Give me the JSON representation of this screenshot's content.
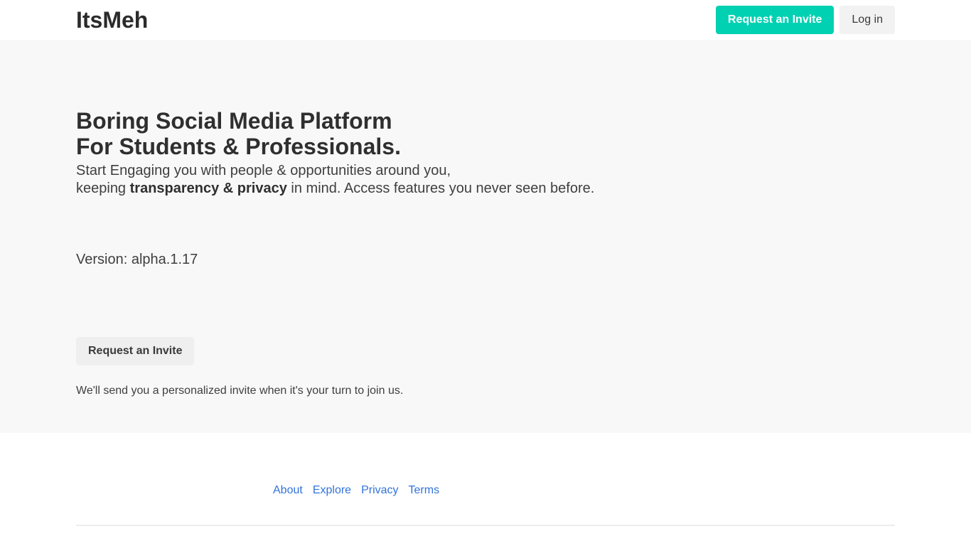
{
  "navbar": {
    "brand": "ItsMeh",
    "request_invite_label": "Request an Invite",
    "login_label": "Log in",
    "accent_color": "#00d1b2"
  },
  "hero": {
    "title_line1": "Boring Social Media Platform",
    "title_line2": "For Students & Professionals.",
    "subtitle_line1": "Start Engaging you with people & opportunities around you,",
    "subtitle_line2_prefix": "keeping ",
    "subtitle_line2_bold": "transparency & privacy",
    "subtitle_line2_suffix": " in mind. Access features you never seen before.",
    "version_text": "Version: alpha.1.17",
    "invite_button_label": "Request an Invite",
    "invite_note": "We'll send you a personalized invite when it's your turn to join us."
  },
  "footer": {
    "links": [
      "About",
      "Explore",
      "Privacy",
      "Terms"
    ],
    "link_color": "#3273dc"
  }
}
